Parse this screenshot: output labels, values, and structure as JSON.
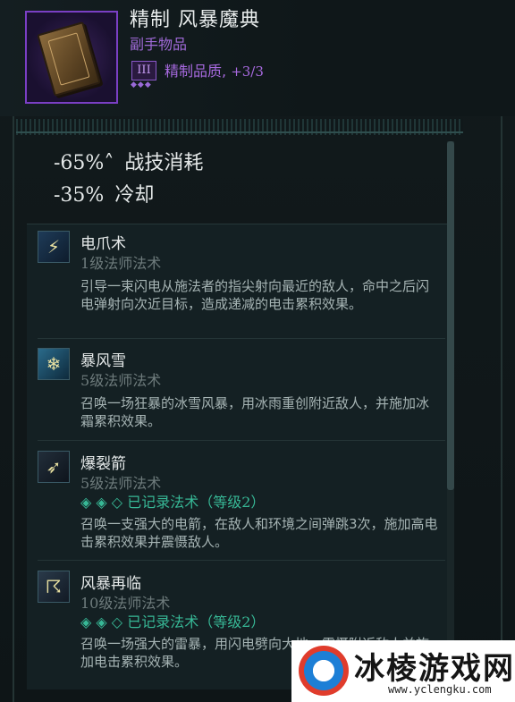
{
  "item": {
    "title": "精制 风暴魔典",
    "type": "副手物品",
    "quality_badge": "III",
    "quality_pips": "◆◆◆",
    "quality_label": "精制品质,",
    "quality_value": "+3/3",
    "icon": "spellbook-icon"
  },
  "stats": [
    {
      "value": "-65%˄",
      "label": "战技消耗"
    },
    {
      "value": "-35%",
      "label": "冷却"
    }
  ],
  "skills": [
    {
      "icon": "lightning-claw-icon",
      "icon_glyph": "⚡",
      "name": "电爪术",
      "level_num": "1",
      "level_text": "级法师法术",
      "recorded": null,
      "desc": "引导一束闪电从施法者的指尖射向最近的敌人，命中之后闪电弹射向次近目标，造成递减的电击累积效果。"
    },
    {
      "icon": "blizzard-icon",
      "icon_glyph": "❄",
      "name": "暴风雪",
      "level_num": "5",
      "level_text": "级法师法术",
      "recorded": null,
      "desc": "召唤一场狂暴的冰雪风暴，用冰雨重创附近敌人，并施加冰霜累积效果。"
    },
    {
      "icon": "thunder-arrow-icon",
      "icon_glyph": "➶",
      "name": "爆裂箭",
      "level_num": "5",
      "level_text": "级法师法术",
      "recorded": {
        "diamonds": "◈ ◈ ◇",
        "label": "已记录法术（等级",
        "level": "2",
        "close": "）"
      },
      "desc": "召唤一支强大的电箭，在敌人和环境之间弹跳3次，施加高电击累积效果并震慑敌人。"
    },
    {
      "icon": "storm-cloud-icon",
      "icon_glyph": "☈",
      "name": "风暴再临",
      "level_num": "10",
      "level_text": "级法师法术",
      "recorded": {
        "diamonds": "◈ ◈ ◇",
        "label": "已记录法术（等级",
        "level": "2",
        "close": "）"
      },
      "desc": "召唤一场强大的雷暴，用闪电劈向大地，震慑附近敌人并施加电击累积效果。"
    }
  ],
  "watermark": {
    "title": "冰棱游戏网",
    "url": "www.yclengku.com"
  },
  "colors": {
    "accent_purple": "#a06ad8",
    "recorded_green": "#37b896",
    "background": "#0f1719"
  }
}
